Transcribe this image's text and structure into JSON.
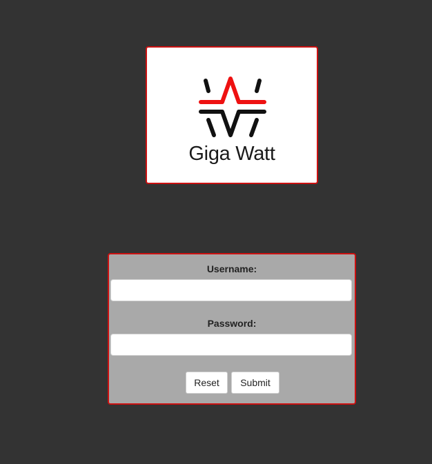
{
  "logo": {
    "text": "Giga Watt",
    "icon": "giga-watt-logo-mark",
    "colors": {
      "black": "#111111",
      "red": "#ee1111",
      "border": "#cc1111"
    }
  },
  "login": {
    "username_label": "Username:",
    "username_value": "",
    "password_label": "Password:",
    "password_value": "",
    "reset_label": "Reset",
    "submit_label": "Submit"
  },
  "theme": {
    "page_background": "#333333",
    "form_background": "#a9a9a9"
  }
}
